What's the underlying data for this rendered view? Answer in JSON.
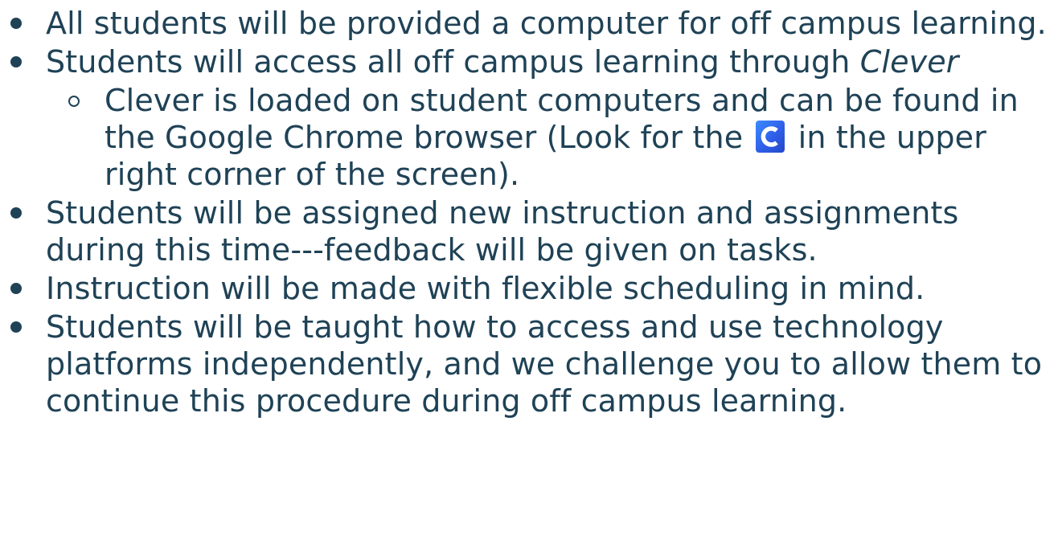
{
  "bullets": [
    {
      "text": "All students will be provided a computer for off campus learning."
    },
    {
      "text_prefix": "Students will access all off campus learning through ",
      "text_italic": "Clever",
      "sub": {
        "text_before_icon": "Clever is loaded on student computers and can be found in the Google Chrome browser (Look for the ",
        "icon": "clever-c-icon",
        "text_after_icon": " in the upper right corner of the screen)."
      }
    },
    {
      "text": "Students will be assigned new instruction and assignments during this time---feedback will be given on tasks."
    },
    {
      "text": "Instruction will be made with flexible scheduling in mind."
    },
    {
      "text": "Students will be taught how to access and use technology platforms independently, and we challenge you to allow them to continue this procedure during off campus learning."
    }
  ],
  "colors": {
    "text": "#1f4256",
    "clever_blue": "#2f5ee8"
  }
}
